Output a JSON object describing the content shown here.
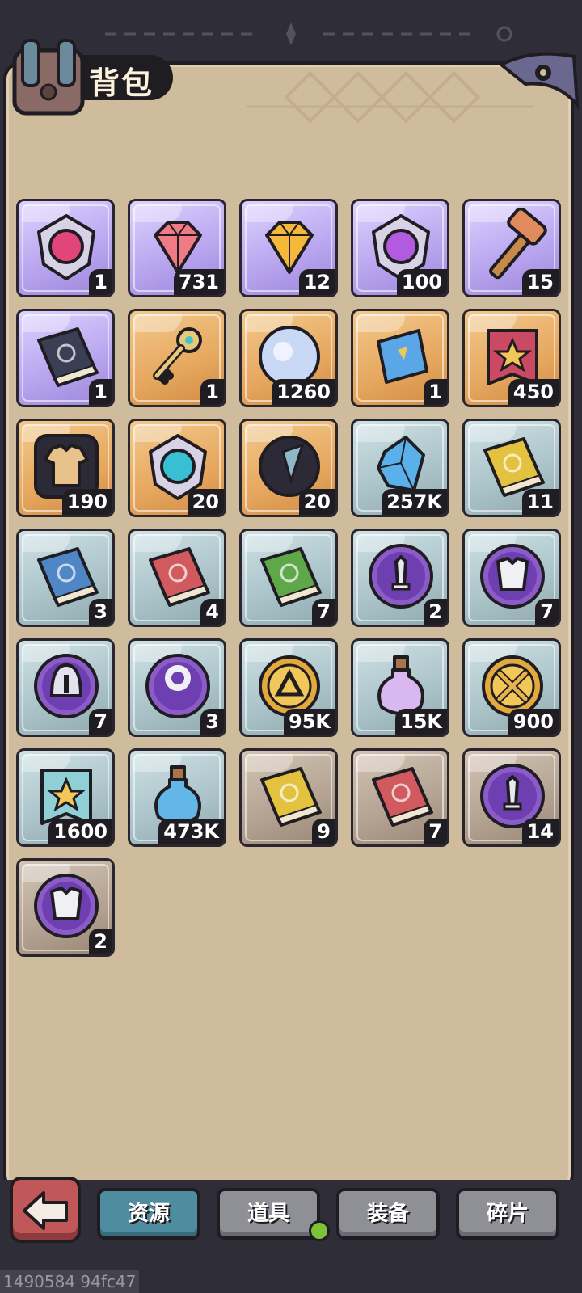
{
  "header": {
    "title": "背包"
  },
  "colors": {
    "background": "#2f2d38",
    "panel": "#cfbc9c",
    "active_tab": "#4e8da0",
    "inactive_tab": "#8f8f96",
    "notice": "#7cc33a"
  },
  "items": [
    {
      "icon": "ornate-medallion-icon",
      "frame": "purple",
      "count": "1"
    },
    {
      "icon": "pink-gem-icon",
      "frame": "purple",
      "count": "731"
    },
    {
      "icon": "gold-gem-icon",
      "frame": "purple",
      "count": "12"
    },
    {
      "icon": "purple-crest-icon",
      "frame": "purple",
      "count": "100"
    },
    {
      "icon": "hammer-icon",
      "frame": "purple",
      "count": "15"
    },
    {
      "icon": "star-book-icon",
      "frame": "purple",
      "count": "1"
    },
    {
      "icon": "key-icon",
      "frame": "orange",
      "count": "1"
    },
    {
      "icon": "crystal-orb-icon",
      "frame": "orange",
      "count": "1260"
    },
    {
      "icon": "blue-ticket-icon",
      "frame": "orange",
      "count": "1"
    },
    {
      "icon": "red-star-banner-icon",
      "frame": "orange",
      "count": "450"
    },
    {
      "icon": "shirt-icon",
      "frame": "orange",
      "count": "190"
    },
    {
      "icon": "teal-crest-icon",
      "frame": "orange",
      "count": "20"
    },
    {
      "icon": "dark-orb-icon",
      "frame": "orange",
      "count": "20"
    },
    {
      "icon": "blue-crystal-icon",
      "frame": "blue",
      "count": "257K"
    },
    {
      "icon": "yellow-book-icon",
      "frame": "blue",
      "count": "11"
    },
    {
      "icon": "blue-book-icon",
      "frame": "blue",
      "count": "3"
    },
    {
      "icon": "red-book-icon",
      "frame": "blue",
      "count": "4"
    },
    {
      "icon": "green-book-icon",
      "frame": "blue",
      "count": "7"
    },
    {
      "icon": "sword-orb-icon",
      "frame": "blue",
      "count": "2"
    },
    {
      "icon": "armor-orb-icon",
      "frame": "blue",
      "count": "7"
    },
    {
      "icon": "helmet-orb-icon",
      "frame": "blue",
      "count": "7"
    },
    {
      "icon": "ring-orb-icon",
      "frame": "blue",
      "count": "3"
    },
    {
      "icon": "gold-emblem-icon",
      "frame": "blue",
      "count": "95K"
    },
    {
      "icon": "purple-potion-icon",
      "frame": "blue",
      "count": "15K"
    },
    {
      "icon": "crossed-swords-coin-icon",
      "frame": "blue",
      "count": "900"
    },
    {
      "icon": "teal-star-banner-icon",
      "frame": "blue",
      "count": "1600"
    },
    {
      "icon": "blue-potion-icon",
      "frame": "blue",
      "count": "473K"
    },
    {
      "icon": "yellow-book-icon",
      "frame": "gray",
      "count": "9"
    },
    {
      "icon": "red-book-glow-icon",
      "frame": "gray",
      "count": "7"
    },
    {
      "icon": "sword-orb-icon",
      "frame": "gray",
      "count": "14"
    },
    {
      "icon": "armor-orb-icon",
      "frame": "gray",
      "count": "2"
    }
  ],
  "tabs": [
    {
      "label": "资源",
      "active": true
    },
    {
      "label": "道具",
      "active": false
    },
    {
      "label": "装备",
      "active": false
    },
    {
      "label": "碎片",
      "active": false
    }
  ],
  "footer": {
    "id_text": "1490584 94fc47"
  }
}
